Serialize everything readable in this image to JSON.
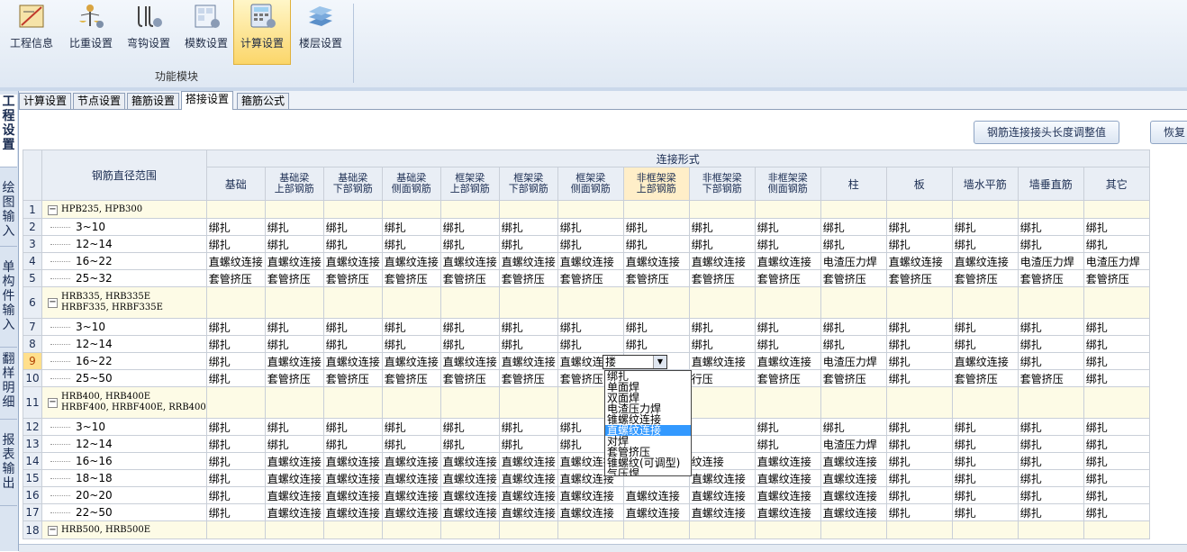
{
  "ribbon": {
    "buttons": [
      {
        "label": "工程信息",
        "icon": "project-info-icon"
      },
      {
        "label": "比重设置",
        "icon": "weight-ratio-icon"
      },
      {
        "label": "弯钩设置",
        "icon": "hook-icon"
      },
      {
        "label": "模数设置",
        "icon": "modulus-icon"
      },
      {
        "label": "计算设置",
        "icon": "calculation-icon"
      },
      {
        "label": "楼层设置",
        "icon": "floor-icon"
      }
    ],
    "group_label": "功能模块"
  },
  "side_tabs": [
    "工程设置",
    "绘图输入",
    "单构件输入",
    "翻样明细",
    "报表输出"
  ],
  "tabs": [
    "计算设置",
    "节点设置",
    "箍筋设置",
    "搭接设置",
    "箍筋公式"
  ],
  "buttons": {
    "adjust": "钢筋连接接头长度调整值",
    "restore": "恢复"
  },
  "grid": {
    "range_header": "钢筋直径范围",
    "group_header": "连接形式",
    "columns": [
      [
        "基础"
      ],
      [
        "基础梁",
        "上部钢筋"
      ],
      [
        "基础梁",
        "下部钢筋"
      ],
      [
        "基础梁",
        "侧面钢筋"
      ],
      [
        "框架梁",
        "上部钢筋"
      ],
      [
        "框架梁",
        "下部钢筋"
      ],
      [
        "框架梁",
        "侧面钢筋"
      ],
      [
        "非框架梁",
        "上部钢筋"
      ],
      [
        "非框架梁",
        "下部钢筋"
      ],
      [
        "非框架梁",
        "侧面钢筋"
      ],
      [
        "柱"
      ],
      [
        "板"
      ],
      [
        "墙水平筋"
      ],
      [
        "墙垂直筋"
      ],
      [
        "其它"
      ]
    ],
    "rows": [
      {
        "no": "1",
        "group": [
          "HPB235, HPB300"
        ]
      },
      {
        "no": "2",
        "range": "3~10",
        "cells": [
          "绑扎",
          "绑扎",
          "绑扎",
          "绑扎",
          "绑扎",
          "绑扎",
          "绑扎",
          "绑扎",
          "绑扎",
          "绑扎",
          "绑扎",
          "绑扎",
          "绑扎",
          "绑扎",
          "绑扎"
        ]
      },
      {
        "no": "3",
        "range": "12~14",
        "cells": [
          "绑扎",
          "绑扎",
          "绑扎",
          "绑扎",
          "绑扎",
          "绑扎",
          "绑扎",
          "绑扎",
          "绑扎",
          "绑扎",
          "绑扎",
          "绑扎",
          "绑扎",
          "绑扎",
          "绑扎"
        ]
      },
      {
        "no": "4",
        "range": "16~22",
        "cells": [
          "直螺纹连接",
          "直螺纹连接",
          "直螺纹连接",
          "直螺纹连接",
          "直螺纹连接",
          "直螺纹连接",
          "直螺纹连接",
          "直螺纹连接",
          "直螺纹连接",
          "直螺纹连接",
          "电渣压力焊",
          "直螺纹连接",
          "直螺纹连接",
          "电渣压力焊",
          "电渣压力焊"
        ]
      },
      {
        "no": "5",
        "range": "25~32",
        "cells": [
          "套管挤压",
          "套管挤压",
          "套管挤压",
          "套管挤压",
          "套管挤压",
          "套管挤压",
          "套管挤压",
          "套管挤压",
          "套管挤压",
          "套管挤压",
          "套管挤压",
          "套管挤压",
          "套管挤压",
          "套管挤压",
          "套管挤压"
        ]
      },
      {
        "no": "6",
        "group": [
          "HRB335, HRB335E",
          "HRBF335, HRBF335E"
        ]
      },
      {
        "no": "7",
        "range": "3~10",
        "cells": [
          "绑扎",
          "绑扎",
          "绑扎",
          "绑扎",
          "绑扎",
          "绑扎",
          "绑扎",
          "绑扎",
          "绑扎",
          "绑扎",
          "绑扎",
          "绑扎",
          "绑扎",
          "绑扎",
          "绑扎"
        ]
      },
      {
        "no": "8",
        "range": "12~14",
        "cells": [
          "绑扎",
          "绑扎",
          "绑扎",
          "绑扎",
          "绑扎",
          "绑扎",
          "绑扎",
          "绑扎",
          "绑扎",
          "绑扎",
          "绑扎",
          "绑扎",
          "绑扎",
          "绑扎",
          "绑扎"
        ]
      },
      {
        "no": "9",
        "range": "16~22",
        "cells": [
          "绑扎",
          "直螺纹连接",
          "直螺纹连接",
          "直螺纹连接",
          "直螺纹连接",
          "直螺纹连接",
          "直螺纹连接",
          "",
          "直螺纹连接",
          "直螺纹连接",
          "电渣压力焊",
          "绑扎",
          "直螺纹连接",
          "绑扎",
          "绑扎"
        ]
      },
      {
        "no": "10",
        "range": "25~50",
        "cells": [
          "绑扎",
          "套管挤压",
          "套管挤压",
          "套管挤压",
          "套管挤压",
          "套管挤压",
          "套管挤压",
          "",
          "行压",
          "套管挤压",
          "套管挤压",
          "绑扎",
          "套管挤压",
          "套管挤压",
          "绑扎"
        ]
      },
      {
        "no": "11",
        "group": [
          "HRB400, HRB400E",
          "HRBF400, HRBF400E, RRB400"
        ]
      },
      {
        "no": "12",
        "range": "3~10",
        "cells": [
          "绑扎",
          "绑扎",
          "绑扎",
          "绑扎",
          "绑扎",
          "绑扎",
          "绑扎",
          "",
          "",
          "绑扎",
          "绑扎",
          "绑扎",
          "绑扎",
          "绑扎",
          "绑扎"
        ]
      },
      {
        "no": "13",
        "range": "12~14",
        "cells": [
          "绑扎",
          "绑扎",
          "绑扎",
          "绑扎",
          "绑扎",
          "绑扎",
          "绑扎",
          "",
          "",
          "绑扎",
          "电渣压力焊",
          "绑扎",
          "绑扎",
          "绑扎",
          "绑扎"
        ]
      },
      {
        "no": "14",
        "range": "16~16",
        "cells": [
          "绑扎",
          "直螺纹连接",
          "直螺纹连接",
          "直螺纹连接",
          "直螺纹连接",
          "直螺纹连接",
          "直螺纹连接",
          "",
          "纹连接",
          "直螺纹连接",
          "直螺纹连接",
          "绑扎",
          "绑扎",
          "绑扎",
          "绑扎"
        ]
      },
      {
        "no": "15",
        "range": "18~18",
        "cells": [
          "绑扎",
          "直螺纹连接",
          "直螺纹连接",
          "直螺纹连接",
          "直螺纹连接",
          "直螺纹连接",
          "直螺纹连接",
          "",
          "直螺纹连接",
          "直螺纹连接",
          "直螺纹连接",
          "绑扎",
          "绑扎",
          "绑扎",
          "绑扎"
        ]
      },
      {
        "no": "16",
        "range": "20~20",
        "cells": [
          "绑扎",
          "直螺纹连接",
          "直螺纹连接",
          "直螺纹连接",
          "直螺纹连接",
          "直螺纹连接",
          "直螺纹连接",
          "直螺纹连接",
          "直螺纹连接",
          "直螺纹连接",
          "直螺纹连接",
          "绑扎",
          "绑扎",
          "绑扎",
          "绑扎"
        ]
      },
      {
        "no": "17",
        "range": "22~50",
        "cells": [
          "绑扎",
          "直螺纹连接",
          "直螺纹连接",
          "直螺纹连接",
          "直螺纹连接",
          "直螺纹连接",
          "直螺纹连接",
          "直螺纹连接",
          "直螺纹连接",
          "直螺纹连接",
          "直螺纹连接",
          "绑扎",
          "绑扎",
          "绑扎",
          "绑扎"
        ]
      },
      {
        "no": "18",
        "group": [
          "HRB500, HRB500E"
        ]
      }
    ]
  },
  "combo": {
    "value": "搂",
    "options": [
      "绑扎",
      "单面焊",
      "双面焊",
      "电渣压力焊",
      "锥螺纹连接",
      "直螺纹连接",
      "对焊",
      "套管挤压",
      "锥螺纹(可调型)",
      "气压焊"
    ],
    "selected": 5
  }
}
